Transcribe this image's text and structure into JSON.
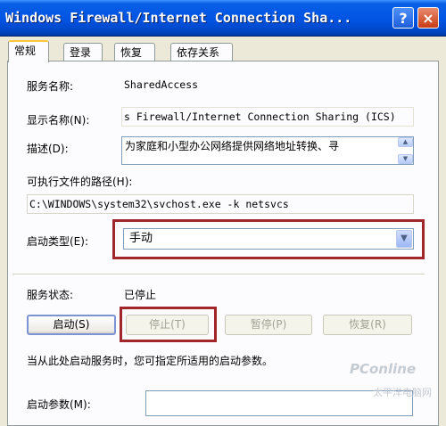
{
  "window": {
    "title": "Windows Firewall/Internet Connection Sha...",
    "help_label": "?",
    "close_label": "×"
  },
  "tabs": [
    {
      "label": "常规",
      "active": true
    },
    {
      "label": "登录",
      "active": false
    },
    {
      "label": "恢复",
      "active": false
    },
    {
      "label": "依存关系",
      "active": false
    }
  ],
  "general": {
    "service_name_label": "服务名称:",
    "service_name_value": "SharedAccess",
    "display_name_label": "显示名称(N):",
    "display_name_value": "s Firewall/Internet Connection Sharing (ICS)",
    "description_label": "描述(D):",
    "description_value": "为家庭和小型办公网络提供网络地址转换、寻",
    "exe_path_label": "可执行文件的路径(H):",
    "exe_path_value": "C:\\WINDOWS\\system32\\svchost.exe -k netsvcs",
    "startup_type_label": "启动类型(E):",
    "startup_type_value": "手动",
    "status_label": "服务状态:",
    "status_value": "已停止",
    "hint": "当从此处启动服务时，您可指定所适用的启动参数。",
    "start_params_label": "启动参数(M):"
  },
  "buttons": {
    "start": "启动(S)",
    "stop": "停止(T)",
    "pause": "暂停(P)",
    "resume": "恢复(R)"
  },
  "watermark": {
    "brand": "PConline",
    "sub": "太平洋电脑网"
  },
  "colors": {
    "highlight_box": "#a0262c",
    "titlebar": "#0054e3"
  }
}
